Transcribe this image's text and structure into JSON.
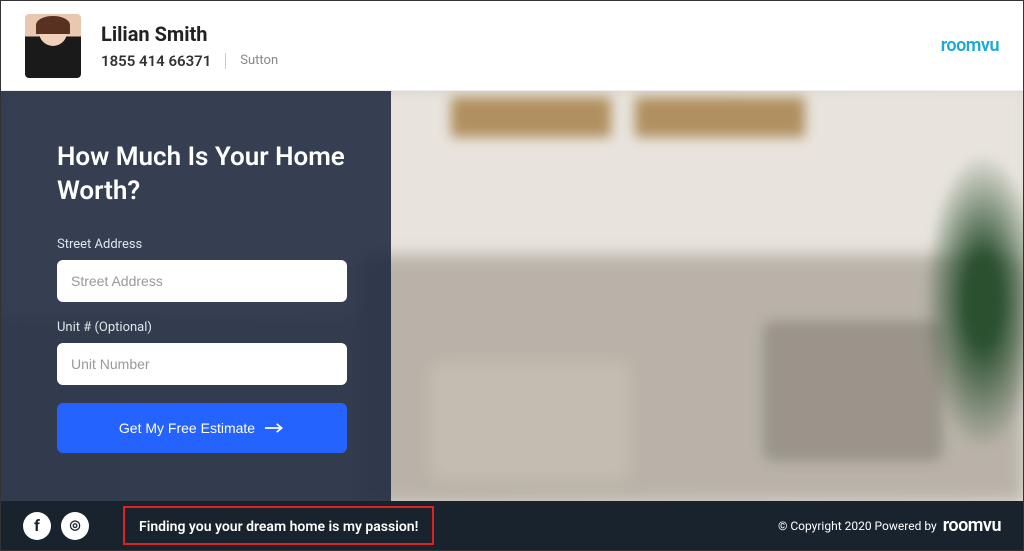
{
  "header": {
    "agent_name": "Lilian Smith",
    "agent_phone": "1855 414 66371",
    "agent_company": "Sutton",
    "brand": "roomvu"
  },
  "hero": {
    "title": "How Much Is Your Home Worth?",
    "street_label": "Street Address",
    "street_placeholder": "Street Address",
    "unit_label": "Unit # (Optional)",
    "unit_placeholder": "Unit Number",
    "submit_label": "Get My Free Estimate"
  },
  "footer": {
    "tagline": "Finding you your dream home is my passion!",
    "copyright": "© Copyright 2020 Powered by",
    "brand": "roomvu"
  }
}
